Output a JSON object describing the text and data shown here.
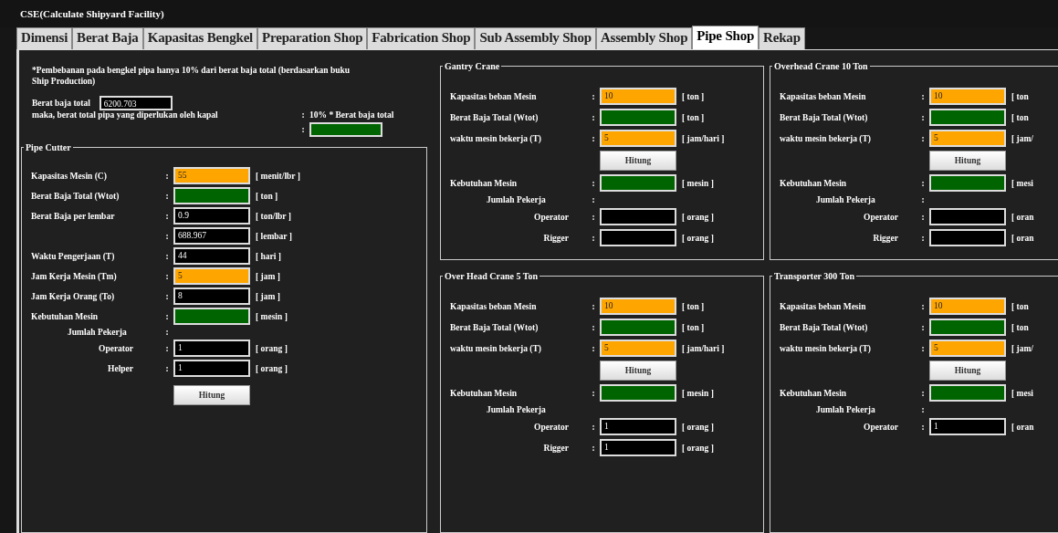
{
  "window": {
    "title": "CSE(Calculate Shipyard Facility)"
  },
  "tabs": [
    {
      "label": "Dimensi",
      "selected": false
    },
    {
      "label": "Berat Baja",
      "selected": false
    },
    {
      "label": "Kapasitas Bengkel",
      "selected": false
    },
    {
      "label": "Preparation Shop",
      "selected": false
    },
    {
      "label": "Fabrication Shop",
      "selected": false
    },
    {
      "label": "Sub Assembly Shop",
      "selected": false
    },
    {
      "label": "Assembly Shop",
      "selected": false
    },
    {
      "label": "Pipe Shop",
      "selected": true
    },
    {
      "label": "Rekap",
      "selected": false
    }
  ],
  "summary": {
    "note": "*Pembebanan pada bengkel pipa hanya 10% dari berat baja total (berdasarkan buku Ship Production)",
    "total_label": "Berat baja total",
    "total_value": "6200.703",
    "result_label": "maka, berat total pipa yang diperlukan oleh kapal",
    "result_sep": ":",
    "formula": "10% * Berat baja total",
    "field_sep": ":",
    "result_field": {
      "kind": "result"
    }
  },
  "columns": [
    {
      "groups": [
        {
          "title": "Pipe Cutter",
          "rows": [
            {
              "kind": "field",
              "label": "Kapasitas Mesin (C)",
              "sep": ":",
              "field": {
                "kind": "input",
                "value": "55"
              },
              "unit": "[ menit/lbr ]"
            },
            {
              "kind": "field",
              "label": "Berat Baja  Total (Wtot)",
              "sep": ":",
              "field": {
                "kind": "result"
              },
              "unit": "[ ton ]"
            },
            {
              "kind": "field",
              "label": "Berat Baja per lembar",
              "sep": ":",
              "field": {
                "kind": "plain",
                "value": "0.9"
              },
              "unit": "[ ton/lbr ]"
            },
            {
              "kind": "field",
              "sep": ":",
              "field": {
                "kind": "plain",
                "value": "688.967"
              },
              "unit": "[ lembar ]"
            },
            {
              "kind": "field",
              "label": "Waktu Pengerjaan (T)",
              "sep": ":",
              "field": {
                "kind": "plain",
                "value": "44"
              },
              "unit": "[ hari ]"
            },
            {
              "kind": "field",
              "label": "Jam Kerja Mesin (Tm)",
              "sep": ":",
              "field": {
                "kind": "input",
                "value": "5"
              },
              "unit": "[ jam ]"
            },
            {
              "kind": "field",
              "label": "Jam Kerja Orang (To)",
              "sep": ":",
              "field": {
                "kind": "plain",
                "value": "8"
              },
              "unit": "[ jam ]"
            },
            {
              "kind": "field",
              "label": "Kebutuhan Mesin",
              "sep": ":",
              "field": {
                "kind": "result"
              },
              "unit": "[ mesin ]"
            },
            {
              "kind": "heading",
              "label": "Jumlah Pekerja",
              "sep": ":"
            },
            {
              "kind": "sub",
              "label": "Operator",
              "sep": ":",
              "field": {
                "kind": "plain",
                "value": "1"
              },
              "unit": "[ orang ]"
            },
            {
              "kind": "sub",
              "label": "Helper",
              "sep": ":",
              "field": {
                "kind": "plain",
                "value": "1"
              },
              "unit": "[ orang ]"
            },
            {
              "kind": "button",
              "label": "Hitung"
            }
          ]
        }
      ]
    },
    {
      "groups": [
        {
          "title": "Gantry Crane",
          "rows": [
            {
              "kind": "field",
              "label": "Kapasitas beban Mesin",
              "sep": ":",
              "field": {
                "kind": "input",
                "value": "10"
              },
              "unit": "[ ton ]"
            },
            {
              "kind": "field",
              "label": "Berat Baja  Total (Wtot)",
              "sep": ":",
              "field": {
                "kind": "result"
              },
              "unit": "[ ton ]"
            },
            {
              "kind": "field",
              "label": "waktu mesin bekerja (T)",
              "sep": ":",
              "field": {
                "kind": "input",
                "value": "5"
              },
              "unit": "[ jam/hari ]"
            },
            {
              "kind": "button",
              "label": "Hitung"
            },
            {
              "kind": "field",
              "label": "Kebutuhan Mesin",
              "sep": ":",
              "field": {
                "kind": "result"
              },
              "unit": "[ mesin ]"
            },
            {
              "kind": "heading",
              "label": "Jumlah Pekerja",
              "sep": ":"
            },
            {
              "kind": "sub",
              "label": "Operator",
              "sep": ":",
              "field": {
                "kind": "plain"
              },
              "unit": "[ orang ]"
            },
            {
              "kind": "sub",
              "label": "Rigger",
              "sep": ":",
              "field": {
                "kind": "plain"
              },
              "unit": "[ orang ]"
            }
          ]
        },
        {
          "title": "Over Head Crane 5 Ton",
          "rows": [
            {
              "kind": "field",
              "label": "Kapasitas beban Mesin",
              "sep": ":",
              "field": {
                "kind": "input",
                "value": "10"
              },
              "unit": "[ ton ]"
            },
            {
              "kind": "field",
              "label": "Berat Baja  Total (Wtot)",
              "sep": ":",
              "field": {
                "kind": "result"
              },
              "unit": "[ ton ]"
            },
            {
              "kind": "field",
              "label": "waktu mesin bekerja (T)",
              "sep": ":",
              "field": {
                "kind": "input",
                "value": "5"
              },
              "unit": "[ jam/hari ]"
            },
            {
              "kind": "button",
              "label": "Hitung"
            },
            {
              "kind": "field",
              "label": "Kebutuhan Mesin",
              "sep": ":",
              "field": {
                "kind": "result"
              },
              "unit": "[ mesin ]"
            },
            {
              "kind": "heading",
              "label": "Jumlah Pekerja"
            },
            {
              "kind": "sub",
              "label": "Operator",
              "sep": ":",
              "field": {
                "kind": "plain",
                "value": "1"
              },
              "unit": "[ orang ]"
            },
            {
              "kind": "sub",
              "label": "Rigger",
              "sep": ":",
              "field": {
                "kind": "plain",
                "value": "1"
              },
              "unit": "[ orang ]"
            }
          ]
        }
      ]
    },
    {
      "groups": [
        {
          "title": "Overhead Crane 10 Ton",
          "rows": [
            {
              "kind": "field",
              "label": "Kapasitas beban Mesin",
              "sep": ":",
              "field": {
                "kind": "input",
                "value": "10"
              },
              "unit": "[ ton"
            },
            {
              "kind": "field",
              "label": "Berat Baja  Total (Wtot)",
              "sep": ":",
              "field": {
                "kind": "result"
              },
              "unit": "[ ton"
            },
            {
              "kind": "field",
              "label": "waktu mesin bekerja (T)",
              "sep": ":",
              "field": {
                "kind": "input",
                "value": "5"
              },
              "unit": "[ jam/"
            },
            {
              "kind": "button",
              "label": "Hitung"
            },
            {
              "kind": "field",
              "label": "Kebutuhan Mesin",
              "sep": ":",
              "field": {
                "kind": "result"
              },
              "unit": "[ mesi"
            },
            {
              "kind": "heading",
              "label": "Jumlah Pekerja",
              "sep": ":"
            },
            {
              "kind": "sub",
              "label": "Operator",
              "sep": ":",
              "field": {
                "kind": "plain"
              },
              "unit": "[ oran"
            },
            {
              "kind": "sub",
              "label": "Rigger",
              "sep": ":",
              "field": {
                "kind": "plain"
              },
              "unit": "[ oran"
            }
          ]
        },
        {
          "title": "Transporter 300 Ton",
          "rows": [
            {
              "kind": "field",
              "label": "Kapasitas beban Mesin",
              "sep": ":",
              "field": {
                "kind": "input",
                "value": "10"
              },
              "unit": "[ ton"
            },
            {
              "kind": "field",
              "label": "Berat Baja  Total (Wtot)",
              "sep": ":",
              "field": {
                "kind": "result"
              },
              "unit": "[ ton"
            },
            {
              "kind": "field",
              "label": "waktu mesin bekerja (T)",
              "sep": ":",
              "field": {
                "kind": "input",
                "value": "5"
              },
              "unit": "[ jam/"
            },
            {
              "kind": "button",
              "label": "Hitung"
            },
            {
              "kind": "field",
              "label": "Kebutuhan Mesin",
              "sep": ":",
              "field": {
                "kind": "result"
              },
              "unit": "[ mesi"
            },
            {
              "kind": "heading",
              "label": "Jumlah Pekerja",
              "sep": ":"
            },
            {
              "kind": "sub",
              "label": "Operator",
              "sep": ":",
              "field": {
                "kind": "plain",
                "value": "1"
              },
              "unit": "[ oran"
            }
          ]
        }
      ]
    }
  ]
}
